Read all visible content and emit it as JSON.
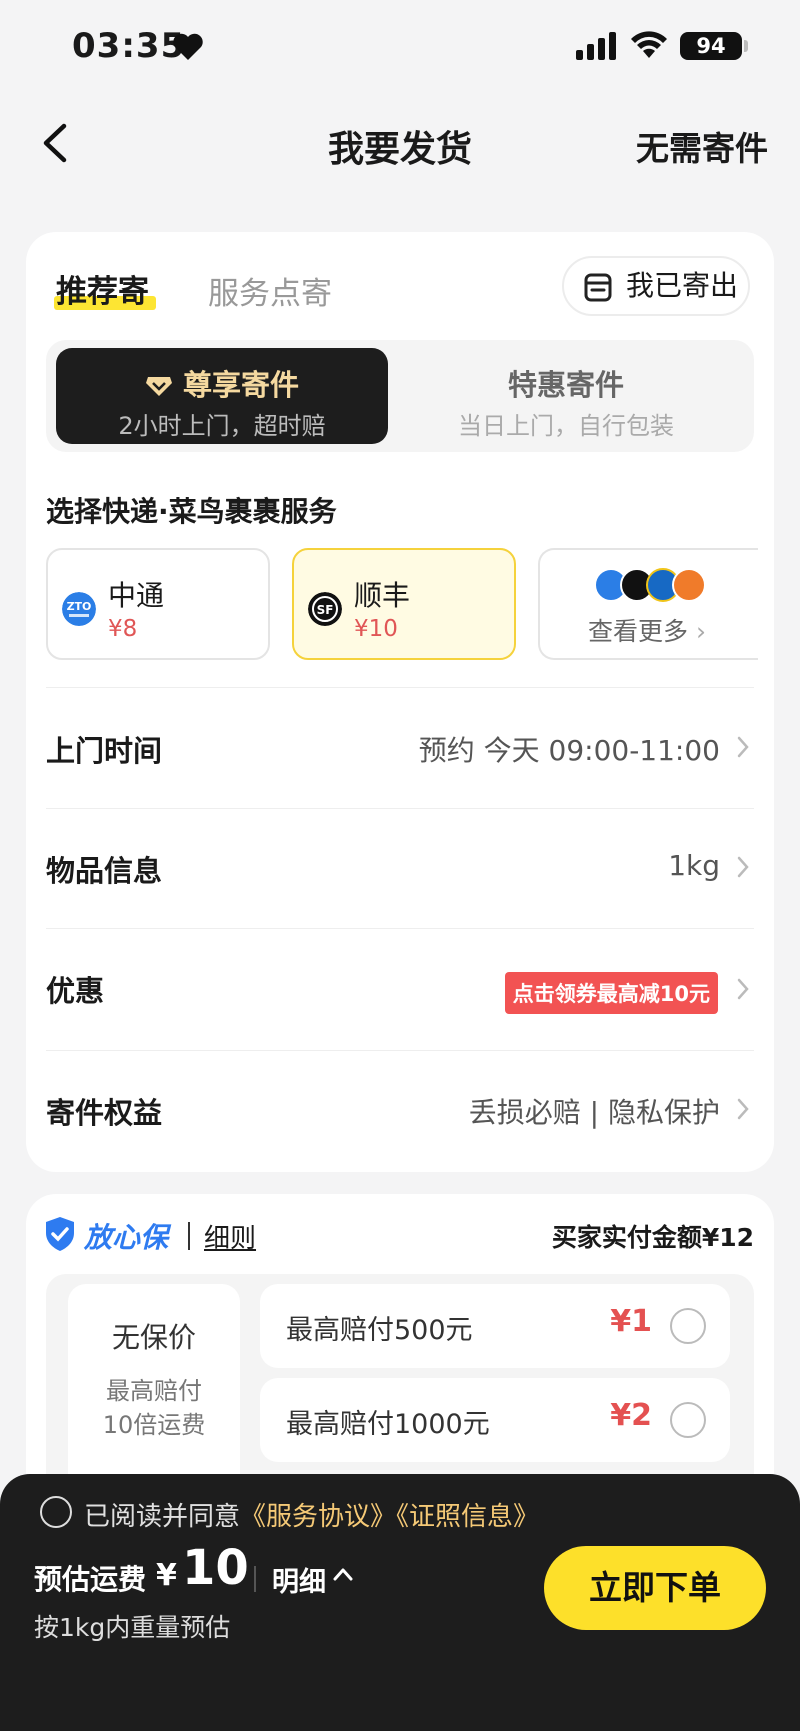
{
  "status_bar": {
    "time": "03:35",
    "battery": "94"
  },
  "nav": {
    "title": "我要发货",
    "right_action": "无需寄件"
  },
  "tabs": {
    "recommend": "推荐寄",
    "service_point": "服务点寄",
    "sent_button": "我已寄出"
  },
  "segments": [
    {
      "title": "尊享寄件",
      "subtitle": "2小时上门，超时赔",
      "selected": true
    },
    {
      "title": "特惠寄件",
      "subtitle": "当日上门，自行包装",
      "selected": false
    }
  ],
  "courier_section": {
    "label": "选择快递·菜鸟裹裹服务",
    "couriers": [
      {
        "name": "中通",
        "price": "¥8",
        "selected": false
      },
      {
        "name": "顺丰",
        "price": "¥10",
        "selected": true
      }
    ],
    "more_label": "查看更多"
  },
  "rows": {
    "pickup_time": {
      "label": "上门时间",
      "value": "预约 今天 09:00-11:00"
    },
    "item_info": {
      "label": "物品信息",
      "value": "1kg"
    },
    "discount": {
      "label": "优惠",
      "value": "点击领券最高减10元"
    },
    "benefits": {
      "label": "寄件权益",
      "value": "丢损必赔 | 隐私保护"
    }
  },
  "insurance": {
    "title": "放心保",
    "rules_link": "细则",
    "buyer_paid": "买家实付金额¥12",
    "none_option": {
      "title": "无保价",
      "sub_line1": "最高赔付",
      "sub_line2": "10倍运费"
    },
    "options": [
      {
        "label": "最高赔付500元",
        "price": "¥1"
      },
      {
        "label": "最高赔付1000元",
        "price": "¥2"
      }
    ]
  },
  "footer": {
    "agree_prefix": "已阅读并同意",
    "agreement_link": "《服务协议》",
    "license_link": "《证照信息》",
    "fee_label": "预估运费",
    "fee_symbol": "¥",
    "fee_amount": "10",
    "detail_label": "明细",
    "fee_note": "按1kg内重量预估",
    "order_button": "立即下单"
  },
  "colors": {
    "accent_yellow": "#fde02a",
    "price_red": "#e45151",
    "brand_blue": "#2e7bf0",
    "dark": "#1d1d1d"
  }
}
